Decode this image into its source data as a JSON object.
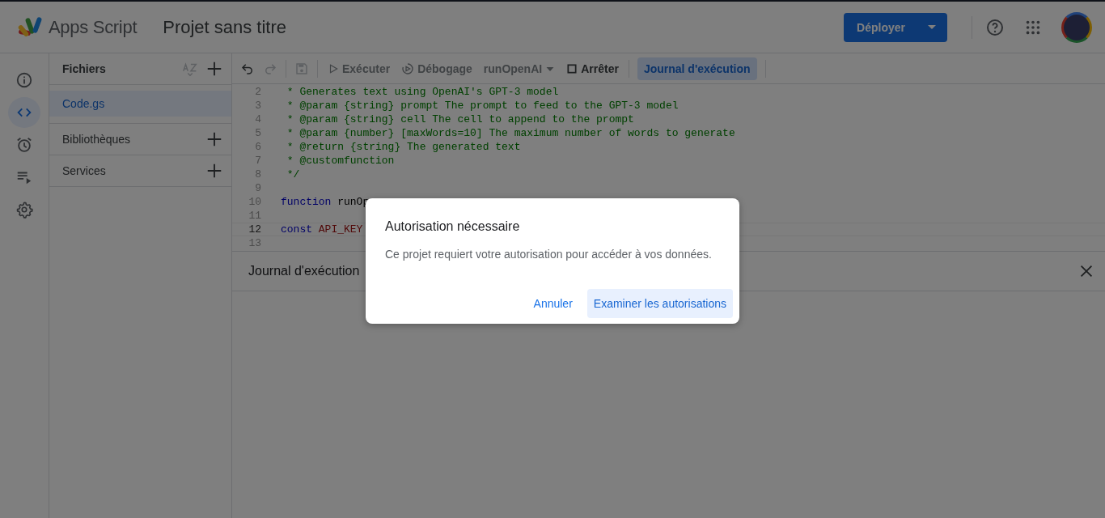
{
  "header": {
    "app_name": "Apps Script",
    "project_title": "Projet sans titre",
    "deploy_button": "Déployer"
  },
  "rail": [
    {
      "kind": "info",
      "selected": false
    },
    {
      "kind": "code",
      "selected": true
    },
    {
      "kind": "triggers",
      "selected": false
    },
    {
      "kind": "executions",
      "selected": false
    },
    {
      "kind": "settings",
      "selected": false
    }
  ],
  "files_panel": {
    "title": "Fichiers",
    "files": [
      {
        "name": "Code.gs",
        "selected": true
      }
    ],
    "sections": [
      {
        "label": "Bibliothèques"
      },
      {
        "label": "Services"
      }
    ]
  },
  "toolbar": [
    {
      "kind": "undo",
      "disabled": false
    },
    {
      "kind": "redo",
      "disabled": true
    },
    {
      "kind": "sep"
    },
    {
      "kind": "save",
      "disabled": true
    },
    {
      "kind": "sep"
    },
    {
      "kind": "run",
      "label": "Exécuter",
      "disabled": true
    },
    {
      "kind": "debug",
      "label": "Débogage",
      "disabled": true
    },
    {
      "kind": "select",
      "label": "runOpenAI",
      "disabled": true
    },
    {
      "kind": "stop",
      "label": "Arrêter",
      "disabled": false
    },
    {
      "kind": "sep"
    },
    {
      "kind": "toggle",
      "label": "Journal d'exécution",
      "selected": true
    },
    {
      "kind": "sep"
    }
  ],
  "code_lines": [
    {
      "number": "2",
      "current": false,
      "segments": [
        {
          "kind": "comment",
          "text": " * Generates text using OpenAI's GPT-3 model"
        }
      ]
    },
    {
      "number": "3",
      "current": false,
      "segments": [
        {
          "kind": "comment",
          "text": " * @param {string} prompt The prompt to feed to the GPT-3 model"
        }
      ]
    },
    {
      "number": "4",
      "current": false,
      "segments": [
        {
          "kind": "comment",
          "text": " * @param {string} cell The cell to append to the prompt"
        }
      ]
    },
    {
      "number": "5",
      "current": false,
      "segments": [
        {
          "kind": "comment",
          "text": " * @param {number} [maxWords=10] The maximum number of words to generate"
        }
      ]
    },
    {
      "number": "6",
      "current": false,
      "segments": [
        {
          "kind": "comment",
          "text": " * @return {string} The generated text"
        }
      ]
    },
    {
      "number": "7",
      "current": false,
      "segments": [
        {
          "kind": "comment",
          "text": " * @customfunction"
        }
      ]
    },
    {
      "number": "8",
      "current": false,
      "segments": [
        {
          "kind": "comment",
          "text": " */"
        }
      ]
    },
    {
      "number": "9",
      "current": false
    },
    {
      "number": "10",
      "current": false,
      "segments": [
        {
          "kind": "keyword",
          "text": "function"
        },
        {
          "kind": "plain",
          "text": "runOp"
        }
      ]
    },
    {
      "number": "11",
      "current": false
    },
    {
      "number": "12",
      "current": true,
      "segments": [
        {
          "kind": "keyword",
          "text": "const"
        },
        {
          "kind": "variable",
          "text": "API_KEY"
        }
      ]
    },
    {
      "number": "13",
      "current": false
    }
  ],
  "log_panel": {
    "title": "Journal d'exécution"
  },
  "dialog": {
    "title": "Autorisation nécessaire",
    "message": "Ce projet requiert votre autorisation pour accéder à vos données.",
    "buttons": [
      {
        "label": "Annuler",
        "kind": "text"
      },
      {
        "label": "Examiner les autorisations",
        "kind": "tonal"
      }
    ]
  }
}
